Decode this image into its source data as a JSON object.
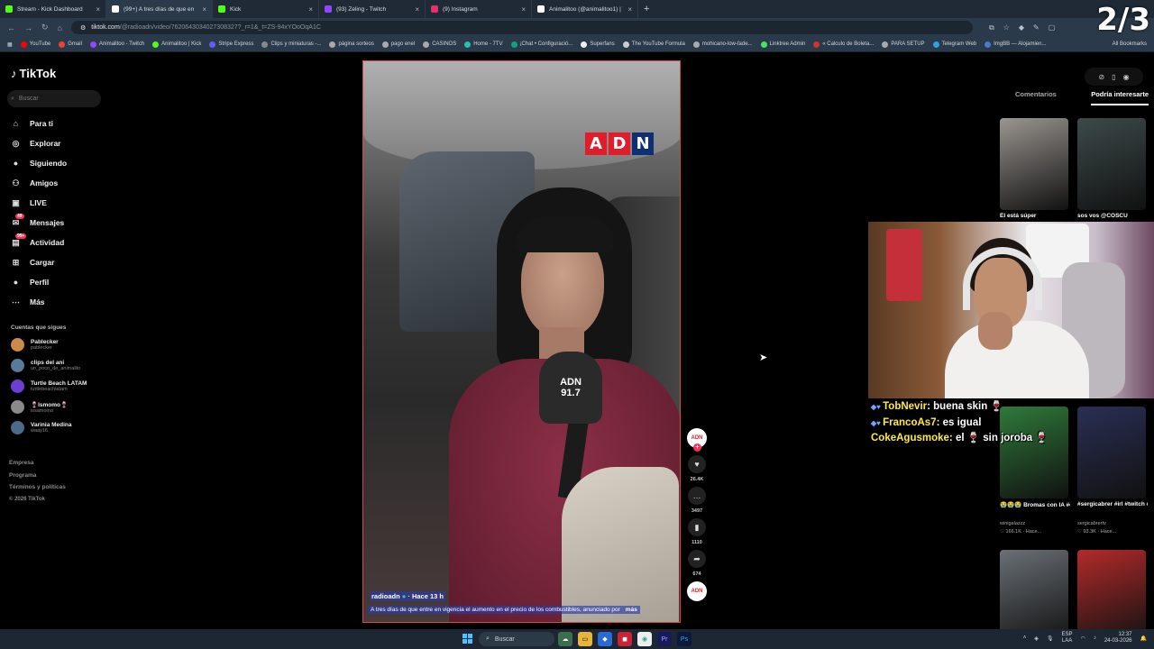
{
  "tabs": [
    {
      "title": "Stream - Kick Dashboard",
      "color": "#53fc18"
    },
    {
      "title": "(99+) A tres días de que en",
      "color": "#ffffff",
      "active": true
    },
    {
      "title": "Kick",
      "color": "#53fc18"
    },
    {
      "title": "(93) Zeling - Twitch",
      "color": "#9146ff"
    },
    {
      "title": "(9) Instagram",
      "color": "#e1306c"
    },
    {
      "title": "Animalitoo (@animalitoo1) | Ti",
      "color": "#ffffff"
    }
  ],
  "overlay_counter": "2/3",
  "address": {
    "host": "tiktok.com",
    "path": "/@radioadn/video/7620643034027308327?_r=1&_t=ZS-94xYOoOqA1C"
  },
  "bookmarks": [
    "YouTube",
    "Gmail",
    "Animalitoo - Twitch",
    "Animalitoo | Kick",
    "Stripe Express",
    "Clips y miniaturas -...",
    "página sorteos",
    "pago enel",
    "CASINOS",
    "Home - 7TV",
    "¡Chat • Configuració...",
    "Superfans",
    "The YouTube Formula",
    "mohicano-low-fade...",
    "Linktree Admin",
    "« Calculo de Boleta...",
    "PARA SETUP",
    "Telegram Web",
    "ImgBB — Alojamien..."
  ],
  "all_bookmarks": "All Bookmarks",
  "sidebar": {
    "logo": "TikTok",
    "search_placeholder": "Buscar",
    "nav": [
      {
        "label": "Para ti",
        "icon": "home-icon",
        "glyph": "⌂"
      },
      {
        "label": "Explorar",
        "icon": "compass-icon",
        "glyph": "◎"
      },
      {
        "label": "Siguiendo",
        "icon": "following-avatar-icon",
        "glyph": "●"
      },
      {
        "label": "Amigos",
        "icon": "friends-icon",
        "glyph": "⚇"
      },
      {
        "label": "LIVE",
        "icon": "live-icon",
        "glyph": "▣"
      },
      {
        "label": "Mensajes",
        "icon": "message-icon",
        "glyph": "✉",
        "badge": "49"
      },
      {
        "label": "Actividad",
        "icon": "activity-icon",
        "glyph": "▤",
        "badge": "99+"
      },
      {
        "label": "Cargar",
        "icon": "upload-icon",
        "glyph": "⊞"
      },
      {
        "label": "Perfil",
        "icon": "profile-icon",
        "glyph": "●"
      },
      {
        "label": "Más",
        "icon": "more-icon",
        "glyph": "⋯"
      }
    ],
    "following_heading": "Cuentas que sigues",
    "accounts": [
      {
        "name": "Pablecker",
        "handle": "pablecker",
        "color": "#c98a4a"
      },
      {
        "name": "clips del ani",
        "handle": "un_poco_de_animalito",
        "color": "#5a7a9a"
      },
      {
        "name": "Turtle Beach LATAM",
        "handle": "turtlebeachlatam",
        "color": "#6b3fd4"
      },
      {
        "name": "🍷Ismomo🍷",
        "handle": "issamomo",
        "color": "#8a8a8a"
      },
      {
        "name": "Varinia Medina",
        "handle": "waay16",
        "color": "#4a6b8a"
      }
    ],
    "footer": [
      "Empresa",
      "Programa",
      "Términos y políticas"
    ],
    "copyright": "© 2026 TikTok"
  },
  "video": {
    "brand": "ADN",
    "mic_label": [
      "ADN",
      "91.7"
    ],
    "author": "radioadn",
    "time": "Hace 13 h",
    "caption": "A tres días de que entre en vigencia el aumento en el precio de los combustibles, anunciado por",
    "more": "más"
  },
  "actions": {
    "likes": "26.4K",
    "comments": "3497",
    "saves": "1110",
    "shares": "674",
    "avatar_label": "ADN"
  },
  "right_panel": {
    "tab_comments": "Comentarios",
    "tab_suggested": "Podría interesarte",
    "thumbs": [
      {
        "caption": "Él está súper",
        "meta": "",
        "color": "#9a9590"
      },
      {
        "caption": "sos vos @COSCU",
        "meta": "",
        "color": "#3d4a4a"
      },
      {
        "caption": "😭😭😭 Bromas con IA #chile...",
        "meta": "winigalazzz\n♡ 166.1K · Hace...",
        "color": "#2f7a3a"
      },
      {
        "caption": "#sergicabrer #irl #twitch #fyp...",
        "meta": "sergicabrertv\n♡ 93.3K · Hace...",
        "color": "#2a2f55"
      },
      {
        "caption": "",
        "meta": "",
        "color": "#6a7076"
      },
      {
        "caption": "",
        "meta": "",
        "color": "#b32a2a"
      }
    ]
  },
  "chat": [
    {
      "user": "TobNevir",
      "message": "buena skin 🍷"
    },
    {
      "user": "FrancoAs7",
      "message": "es igual"
    },
    {
      "user": "CokeAgusmoke",
      "message": "el 🍷 sin joroba 🍷"
    }
  ],
  "taskbar": {
    "search": "Buscar",
    "lang": [
      "ESP",
      "LAA"
    ],
    "time": "12:37",
    "date": "24-03-2026"
  }
}
